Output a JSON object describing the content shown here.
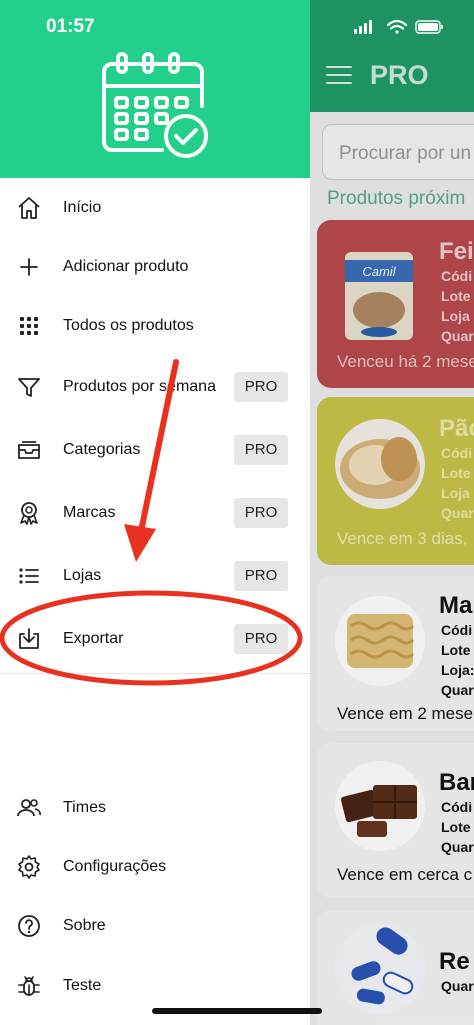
{
  "status_bar": {
    "time": "01:57"
  },
  "background": {
    "title": "PRO",
    "search_placeholder": "Procurar por un",
    "section_label": "Produtos próxim",
    "cards": [
      {
        "name": "Fei",
        "details": [
          "Códi",
          "Lote",
          "Loja",
          "Quar"
        ],
        "status": "Venceu há 2 mese"
      },
      {
        "name": "Pão",
        "details": [
          "Códi",
          "Lote",
          "Loja",
          "Quar"
        ],
        "status": "Vence em 3 dias,"
      },
      {
        "name": "Ma",
        "details": [
          "Códi",
          "Lote",
          "Loja:",
          "Quar"
        ],
        "status": "Vence em 2 mese"
      },
      {
        "name": "Bar",
        "details": [
          "Códi",
          "Lote",
          "Quar"
        ],
        "status": "Vence em cerca c"
      },
      {
        "name": "Re",
        "details": [
          "Quar"
        ],
        "status": ""
      }
    ],
    "package_text": "Camil"
  },
  "drawer": {
    "items": [
      {
        "label": "Início",
        "icon": "home-icon"
      },
      {
        "label": "Adicionar produto",
        "icon": "plus-icon"
      },
      {
        "label": "Todos os produtos",
        "icon": "grid-icon"
      },
      {
        "label": "Produtos por semana",
        "icon": "filter-icon",
        "badge": "PRO"
      },
      {
        "label": "Categorias",
        "icon": "inbox-icon",
        "badge": "PRO"
      },
      {
        "label": "Marcas",
        "icon": "award-icon",
        "badge": "PRO"
      },
      {
        "label": "Lojas",
        "icon": "list-icon",
        "badge": "PRO"
      },
      {
        "label": "Exportar",
        "icon": "download-icon",
        "badge": "PRO"
      }
    ],
    "footer_items": [
      {
        "label": "Times",
        "icon": "users-icon"
      },
      {
        "label": "Configurações",
        "icon": "settings-icon"
      },
      {
        "label": "Sobre",
        "icon": "help-icon"
      },
      {
        "label": "Teste",
        "icon": "bug-icon"
      }
    ]
  },
  "colors": {
    "brand_green": "#22cf8b",
    "annotation_red": "#e8321f",
    "card_expired": "#b84a4e",
    "card_warning": "#c8c54a"
  }
}
